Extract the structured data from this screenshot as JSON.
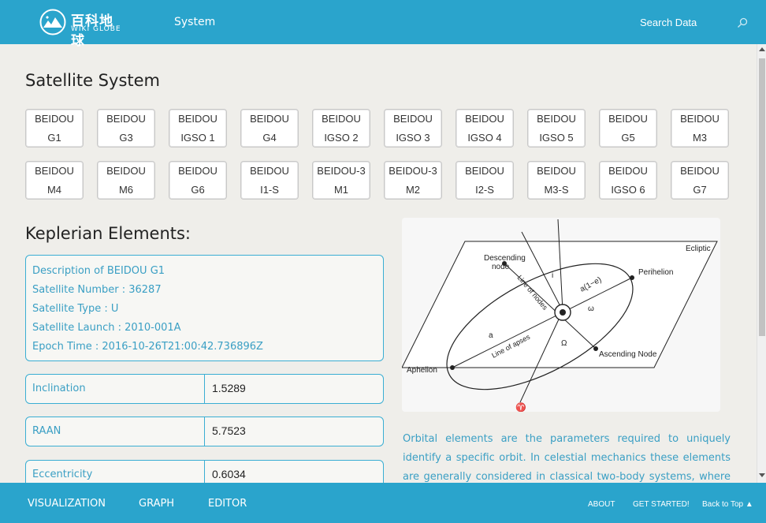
{
  "header": {
    "logo_cn": "百科地球",
    "logo_en": "WIKI GLOBE",
    "nav_system": "System",
    "search_label": "Search Data"
  },
  "satellite_section": {
    "title": "Satellite System",
    "buttons": [
      [
        "BEIDOU",
        "G1"
      ],
      [
        "BEIDOU",
        "G3"
      ],
      [
        "BEIDOU",
        "IGSO 1"
      ],
      [
        "BEIDOU",
        "G4"
      ],
      [
        "BEIDOU",
        "IGSO 2"
      ],
      [
        "BEIDOU",
        "IGSO 3"
      ],
      [
        "BEIDOU",
        "IGSO 4"
      ],
      [
        "BEIDOU",
        "IGSO 5"
      ],
      [
        "BEIDOU",
        "G5"
      ],
      [
        "BEIDOU",
        "M3"
      ],
      [
        "BEIDOU",
        "M4"
      ],
      [
        "BEIDOU",
        "M6"
      ],
      [
        "BEIDOU",
        "G6"
      ],
      [
        "BEIDOU",
        "I1-S"
      ],
      [
        "BEIDOU-3",
        "M1"
      ],
      [
        "BEIDOU-3",
        "M2"
      ],
      [
        "BEIDOU",
        "I2-S"
      ],
      [
        "BEIDOU",
        "M3-S"
      ],
      [
        "BEIDOU",
        "IGSO 6"
      ],
      [
        "BEIDOU",
        "G7"
      ]
    ]
  },
  "kepler": {
    "title": "Keplerian Elements:",
    "description": [
      "Description of BEIDOU G1",
      "Satellite Number : 36287",
      "Satellite Type : U",
      "Satellite Launch : 2010-001A",
      "Epoch Time : 2016-10-26T21:00:42.736896Z"
    ],
    "fields": [
      {
        "label": "Inclination",
        "value": "1.5289"
      },
      {
        "label": "RAAN",
        "value": "5.7523"
      },
      {
        "label": "Eccentricity",
        "value": "0.6034"
      }
    ]
  },
  "diagram": {
    "labels": {
      "ecliptic": "Ecliptic",
      "descending": "Descending",
      "node": "node",
      "line_of_nodes": "Line of nodes",
      "perihelion": "Perihelion",
      "a1e": "a(1−e)",
      "a": "a",
      "line_of_apses": "Line of apses",
      "omega_small": "ω",
      "omega_big": "Ω",
      "i": "i",
      "aphelion": "Aphelion",
      "ascending": "Ascending Node",
      "aries": "♈"
    }
  },
  "paragraph": "Orbital elements are the parameters required to uniquely identify a specific orbit. In celestial mechanics these elements are generally considered in classical two-body systems, where a Kepler orbit is used.",
  "footer": {
    "visualization": "VISUALIZATION",
    "graph": "GRAPH",
    "editor": "EDITOR",
    "about": "ABOUT",
    "get_started": "GET STARTED!",
    "back_to_top": "Back to Top ▲"
  }
}
